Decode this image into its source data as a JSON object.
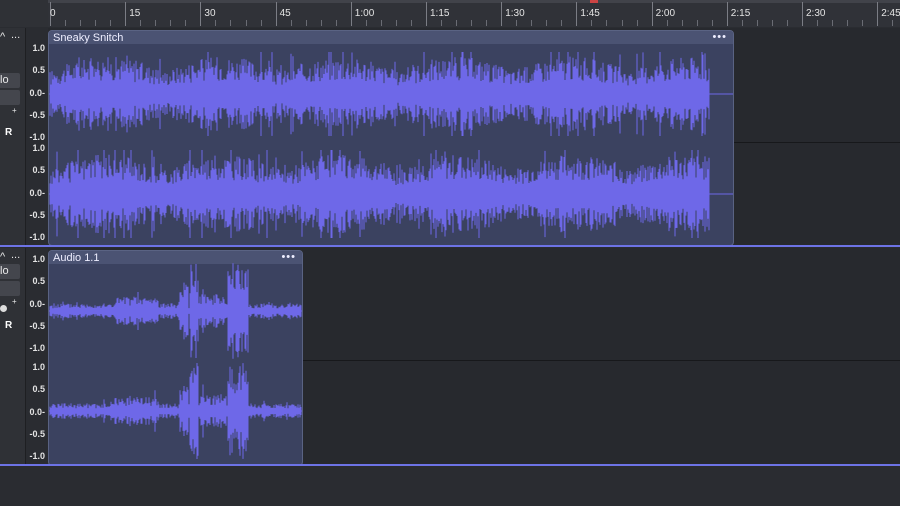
{
  "ruler": {
    "ticks": [
      "0",
      "15",
      "30",
      "45",
      "1:00",
      "1:15",
      "1:30",
      "1:45",
      "2:00",
      "2:15",
      "2:30",
      "2:45"
    ]
  },
  "tracks": [
    {
      "header": {
        "collapse": "^",
        "menu": "...",
        "solo": "lo",
        "pan_plus": "+",
        "r_label": "R"
      },
      "clip": {
        "title": "Sneaky Snitch",
        "menu": "•••"
      },
      "channels": [
        {
          "scale": [
            "1.0",
            "0.5",
            "0.0-",
            "-0.5",
            "-1.0"
          ]
        },
        {
          "scale": [
            "1.0",
            "0.5",
            "0.0-",
            "-0.5",
            "-1.0"
          ]
        }
      ]
    },
    {
      "header": {
        "collapse": "^",
        "menu": "...",
        "solo": "lo",
        "pan_plus": "+",
        "r_label": "R"
      },
      "clip": {
        "title": "Audio 1.1",
        "menu": "•••"
      },
      "channels": [
        {
          "scale": [
            "1.0",
            "0.5",
            "0.0-",
            "-0.5",
            "-1.0"
          ]
        },
        {
          "scale": [
            "1.0",
            "0.5",
            "0.0-",
            "-0.5",
            "-1.0"
          ]
        }
      ]
    }
  ],
  "colors": {
    "waveform": "#6e68e8",
    "clip_bg": "#3b4260",
    "selection": "#6d73e6"
  }
}
